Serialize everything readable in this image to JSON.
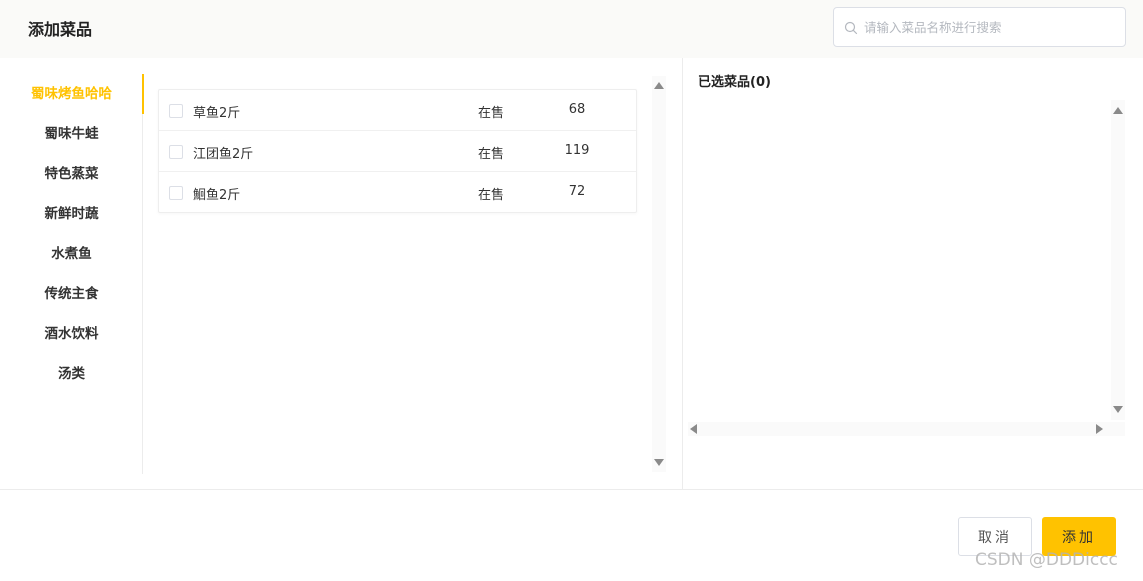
{
  "header": {
    "title": "添加菜品",
    "search_placeholder": "请输入菜品名称进行搜索",
    "search_value": ""
  },
  "categories": [
    {
      "label": "蜀味烤鱼哈哈",
      "active": true
    },
    {
      "label": "蜀味牛蛙",
      "active": false
    },
    {
      "label": "特色蒸菜",
      "active": false
    },
    {
      "label": "新鲜时蔬",
      "active": false
    },
    {
      "label": "水煮鱼",
      "active": false
    },
    {
      "label": "传统主食",
      "active": false
    },
    {
      "label": "酒水饮料",
      "active": false
    },
    {
      "label": "汤类",
      "active": false
    }
  ],
  "dishes": [
    {
      "name": "草鱼2斤",
      "status": "在售",
      "price": "68",
      "checked": false
    },
    {
      "name": "江团鱼2斤",
      "status": "在售",
      "price": "119",
      "checked": false
    },
    {
      "name": "鮰鱼2斤",
      "status": "在售",
      "price": "72",
      "checked": false
    }
  ],
  "selected_panel": {
    "title": "已选菜品(0)"
  },
  "footer": {
    "cancel_label": "取消",
    "add_label": "添加"
  },
  "watermark": "CSDN @DDDiccc",
  "colors": {
    "accent": "#ffc200",
    "border": "#dcdfe6"
  }
}
